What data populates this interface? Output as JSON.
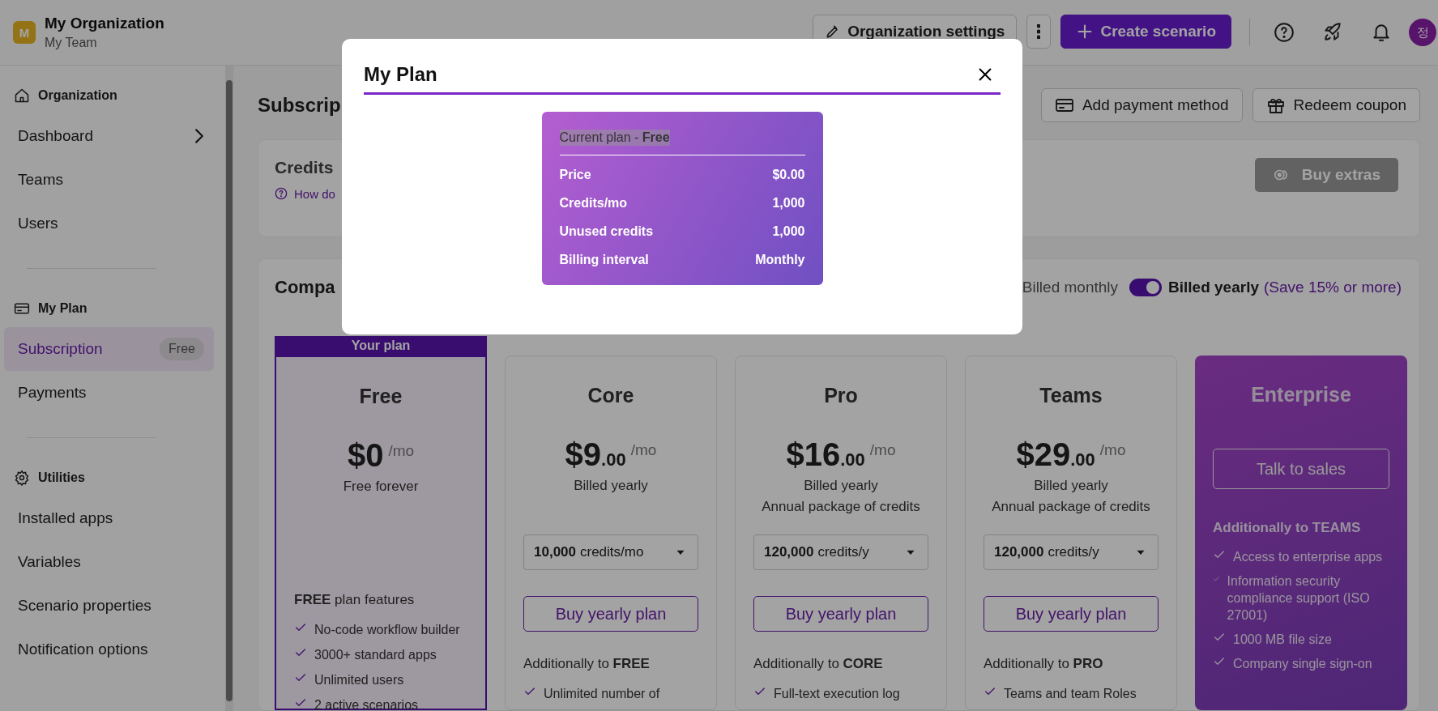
{
  "header": {
    "org_initial": "M",
    "org_name": "My Organization",
    "team_name": "My Team",
    "settings_button": "Organization settings",
    "create_button": "Create scenario",
    "avatar_initial": "정"
  },
  "sidebar": {
    "sections": [
      {
        "title": "Organization",
        "items": [
          {
            "label": "Dashboard",
            "selected": false,
            "expandable": true
          },
          {
            "label": "Teams",
            "selected": false,
            "expandable": false
          },
          {
            "label": "Users",
            "selected": false,
            "expandable": false
          }
        ]
      },
      {
        "title": "My Plan",
        "items": [
          {
            "label": "Subscription",
            "selected": true,
            "expandable": false,
            "badge": "Free"
          },
          {
            "label": "Payments",
            "selected": false,
            "expandable": false
          }
        ]
      },
      {
        "title": "Utilities",
        "items": [
          {
            "label": "Installed apps",
            "selected": false,
            "expandable": false
          },
          {
            "label": "Variables",
            "selected": false,
            "expandable": false
          },
          {
            "label": "Scenario properties",
            "selected": false,
            "expandable": false
          },
          {
            "label": "Notification options",
            "selected": false,
            "expandable": false
          }
        ]
      }
    ]
  },
  "page": {
    "title": "Subscrip",
    "actions": [
      "Add payment method",
      "Redeem coupon"
    ]
  },
  "credits_panel": {
    "title": "Credits",
    "help_link": "How do",
    "buy_button": {
      "label": "Buy extras",
      "disabled": true
    }
  },
  "compare": {
    "title": "Compa",
    "billing": {
      "monthly_label": "Billed monthly",
      "yearly_on": true,
      "yearly_label": "Billed yearly",
      "save_note": "(Save 15% or more)"
    }
  },
  "plans": [
    {
      "kind": "standard",
      "current": true,
      "badge": "Your plan",
      "name": "Free",
      "amount": "$0",
      "period": "/mo",
      "notes": [
        "Free forever"
      ],
      "features_title": "**FREE** plan features",
      "features": [
        "No-code workflow builder",
        "3000+ standard apps",
        "Unlimited users",
        "2 active scenarios"
      ]
    },
    {
      "kind": "standard",
      "current": false,
      "name": "Core",
      "amount": "$9",
      "cents": ".00",
      "period": "/mo",
      "notes": [
        "Billed yearly"
      ],
      "credits": {
        "amount": "10,000",
        "unit": "credits/mo"
      },
      "button": "Buy yearly plan",
      "features_title": "Additionally to **FREE**",
      "features": [
        "Unlimited number of"
      ]
    },
    {
      "kind": "standard",
      "current": false,
      "name": "Pro",
      "amount": "$16",
      "cents": ".00",
      "period": "/mo",
      "notes": [
        "Billed yearly",
        "Annual package of credits"
      ],
      "credits": {
        "amount": "120,000",
        "unit": "credits/y"
      },
      "button": "Buy yearly plan",
      "features_title": "Additionally to **CORE**",
      "features": [
        "Full-text execution log"
      ]
    },
    {
      "kind": "standard",
      "current": false,
      "name": "Teams",
      "amount": "$29",
      "cents": ".00",
      "period": "/mo",
      "notes": [
        "Billed yearly",
        "Annual package of credits"
      ],
      "credits": {
        "amount": "120,000",
        "unit": "credits/y"
      },
      "button": "Buy yearly plan",
      "features_title": "Additionally to **PRO**",
      "features": [
        "Teams and team Roles"
      ]
    },
    {
      "kind": "enterprise",
      "current": false,
      "name": "Enterprise",
      "button": "Talk to sales",
      "features_title": "Additionally to **TEAMS**",
      "features": [
        "Access to enterprise apps",
        "Information security compliance support (ISO 27001)",
        "1000 MB file size",
        "Company single sign-on"
      ]
    }
  ],
  "modal": {
    "title": "My Plan",
    "plan_card": {
      "title": "Current plan - **Free**",
      "rows": [
        {
          "label": "Price",
          "value": "$0.00"
        },
        {
          "label": "Credits/mo",
          "value": "1,000"
        },
        {
          "label": "Unused credits",
          "value": "1,000"
        },
        {
          "label": "Billing interval",
          "value": "Monthly"
        }
      ]
    }
  }
}
